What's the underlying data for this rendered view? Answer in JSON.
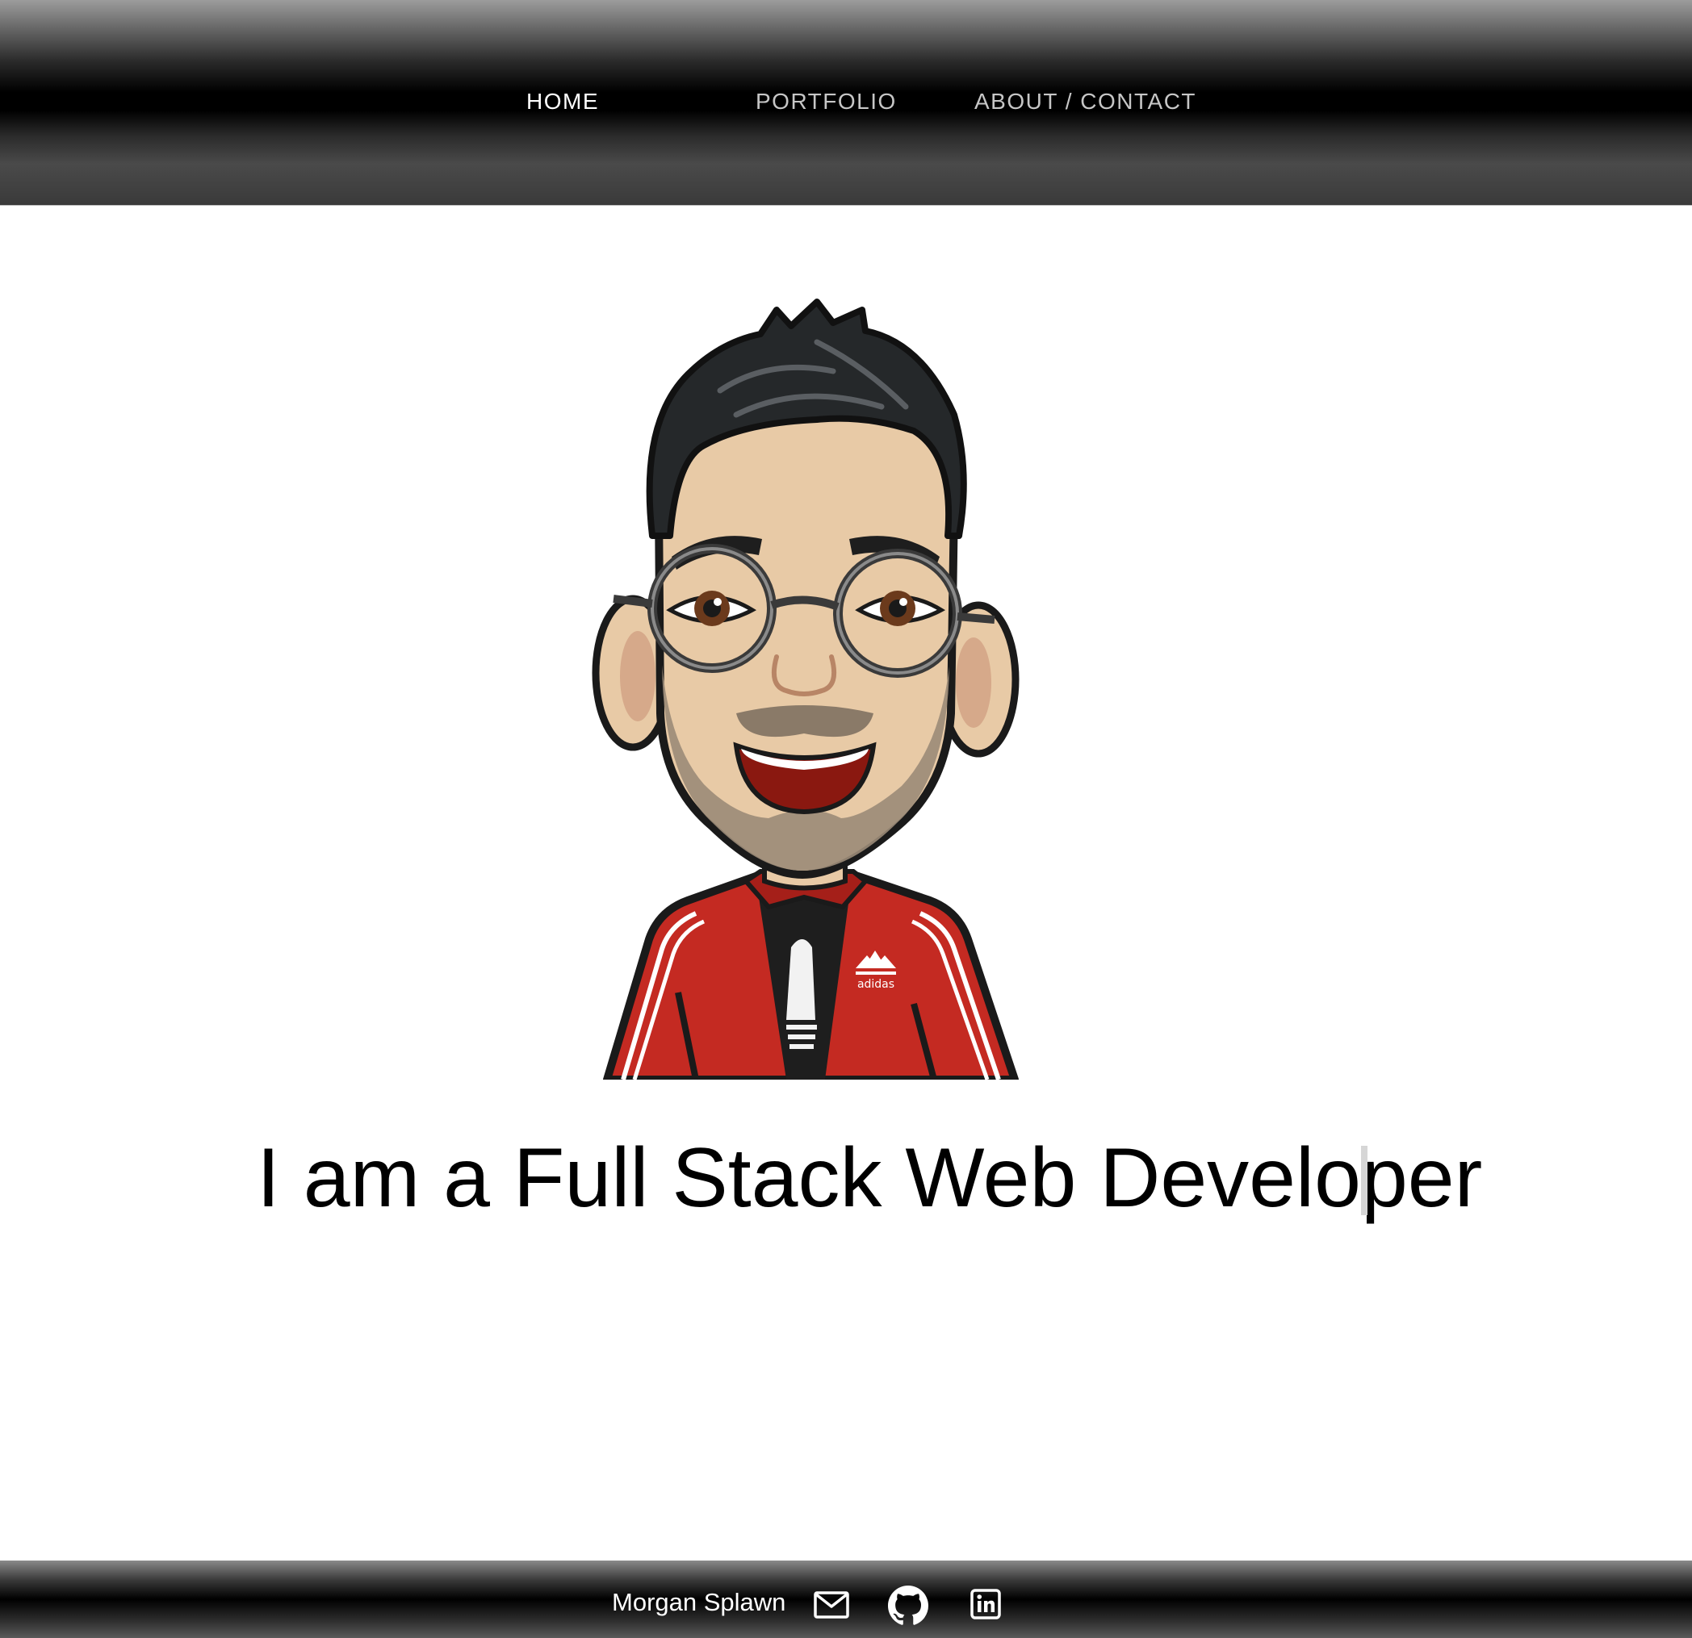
{
  "nav": {
    "items": [
      {
        "label": "HOME",
        "active": true
      },
      {
        "label": "PORTFOLIO",
        "active": false
      },
      {
        "label": "ABOUT / CONTACT",
        "active": false
      }
    ]
  },
  "hero": {
    "avatar_icon": "bitmoji-avatar",
    "tagline": "I am a Full Stack Web Developer"
  },
  "footer": {
    "name": "Morgan Splawn",
    "icons": [
      "mail-icon",
      "github-icon",
      "linkedin-icon"
    ]
  },
  "colors": {
    "header_black": "#000000",
    "nav_active": "#ffffff",
    "nav_inactive": "#c6c6c6",
    "jacket_red": "#c42a22",
    "cursor": "#d6d6d6"
  }
}
